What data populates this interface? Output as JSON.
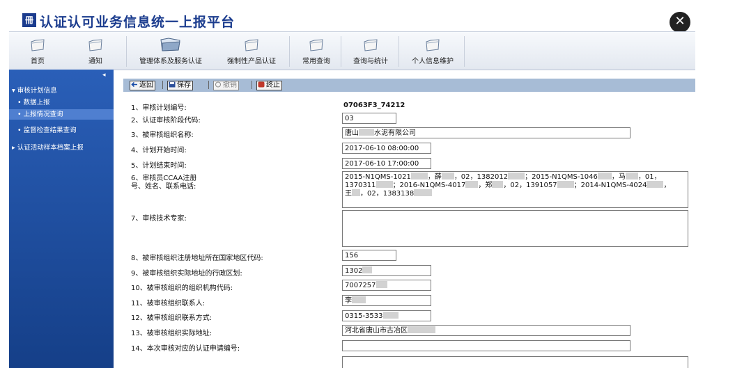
{
  "app": {
    "logo_text": "冊",
    "title": "认证认可业务信息统一上报平台",
    "close_icon": "close-icon"
  },
  "nav": {
    "home": "首页",
    "notice": "通知",
    "mgmt": "管理体系及服务认证",
    "mandatory": "强制性产品认证",
    "common_query": "常用查询",
    "query_stats": "查询与统计",
    "personal": "个人信息维护"
  },
  "sidebar": {
    "collapse": "◂",
    "group1": "▾ 审核计划信息",
    "items": [
      "• 数据上报",
      "• 上报情况查询",
      "• 监督检查结果查询"
    ],
    "group2": "▸ 认证活动样本档案上报",
    "active_index": 1
  },
  "toolbar": {
    "back": "返回",
    "save": "保存",
    "cancel": "撤销",
    "stop": "终止"
  },
  "form": {
    "l1": "1、审核计划编号:",
    "l2": "2、认证审核阶段代码:",
    "l3": "3、被审核组织名称:",
    "l4": "4、计划开始时间:",
    "l5": "5、计划结束时间:",
    "l6a": "6、审核员CCAA注册",
    "l6b": "号、姓名、联系电话:",
    "l7": "7、审核技术专家:",
    "l8": "8、被审核组织注册地址所在国家地区代码:",
    "l9": "9、被审核组织实际地址的行政区划:",
    "l10": "10、被审核组织的组织机构代码:",
    "l11": "11、被审核组织联系人:",
    "l12": "12、被审核组织联系方式:",
    "l13": "13、被审核组织实际地址:",
    "l14": "14、本次审核对应的认证申请编号:",
    "v1": "07063F3_74212",
    "v2": "03",
    "v3a": "唐山",
    "v3b": "水泥有限公司",
    "v4": "2017-06-10 08:00:00",
    "v5": "2017-06-10 17:00:00",
    "v6": {
      "a1": "2015-N1QMS-1021",
      "a2": "，薛",
      "a3": "，02，1382012",
      "a4": "；2015-N1QMS-1046",
      "a5": "，马",
      "a6": "，01，",
      "b1": "1370311",
      "b2": "；2016-N1QMS-4017",
      "b3": "，郑",
      "b4": "，02，1391057",
      "b5": "；2014-N1QMS-4024",
      "b6": "，",
      "c1": "王",
      "c2": "，02，1383138"
    },
    "v7": "",
    "v8": "156",
    "v9": "1302",
    "v10": "7007257",
    "v11": "李",
    "v12": "0315-3533",
    "v13": "河北省唐山市古冶区",
    "v14": ""
  }
}
